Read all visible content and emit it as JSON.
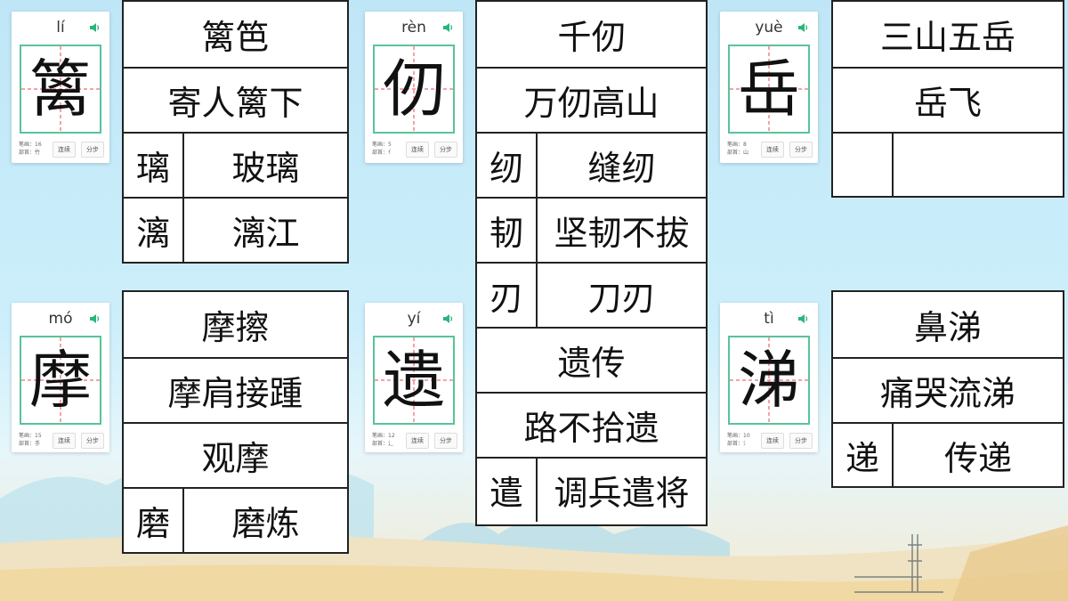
{
  "cards": [
    {
      "pinyin": "lí",
      "char": "篱",
      "strokes": "笔画：16",
      "radical": "部首：竹",
      "btn_continuous": "连续",
      "btn_step": "分步"
    },
    {
      "pinyin": "rèn",
      "char": "仞",
      "strokes": "笔画：5",
      "radical": "部首：亻",
      "btn_continuous": "连续",
      "btn_step": "分步"
    },
    {
      "pinyin": "yuè",
      "char": "岳",
      "strokes": "笔画：8",
      "radical": "部首：山",
      "btn_continuous": "连续",
      "btn_step": "分步"
    },
    {
      "pinyin": "mó",
      "char": "摩",
      "strokes": "笔画：15",
      "radical": "部首：手",
      "btn_continuous": "连续",
      "btn_step": "分步"
    },
    {
      "pinyin": "yí",
      "char": "遗",
      "strokes": "笔画：12",
      "radical": "部首：辶",
      "btn_continuous": "连续",
      "btn_step": "分步"
    },
    {
      "pinyin": "tì",
      "char": "涕",
      "strokes": "笔画：10",
      "radical": "部首：氵",
      "btn_continuous": "连续",
      "btn_step": "分步"
    }
  ],
  "tables": {
    "li": {
      "r0": "篱笆",
      "r1": "寄人篱下",
      "r2a": "璃",
      "r2b": "玻璃",
      "r3a": "漓",
      "r3b": "漓江"
    },
    "ren": {
      "r0": "千仞",
      "r1": "万仞高山",
      "r2a": "纫",
      "r2b": "缝纫",
      "r3a": "韧",
      "r3b": "坚韧不拔",
      "r4a": "刃",
      "r4b": "刀刃",
      "r5": "遗传",
      "r6": "路不拾遗",
      "r7a": "遣",
      "r7b": "调兵遣将"
    },
    "yue": {
      "r0": "三山五岳",
      "r1": "岳飞",
      "r2a": "",
      "r2b": ""
    },
    "mo": {
      "r0": "摩擦",
      "r1": "摩肩接踵",
      "r2": "观摩",
      "r3a": "磨",
      "r3b": "磨炼"
    },
    "ti": {
      "r0": "鼻涕",
      "r1": "痛哭流涕",
      "r2a": "递",
      "r2b": "传递"
    }
  }
}
